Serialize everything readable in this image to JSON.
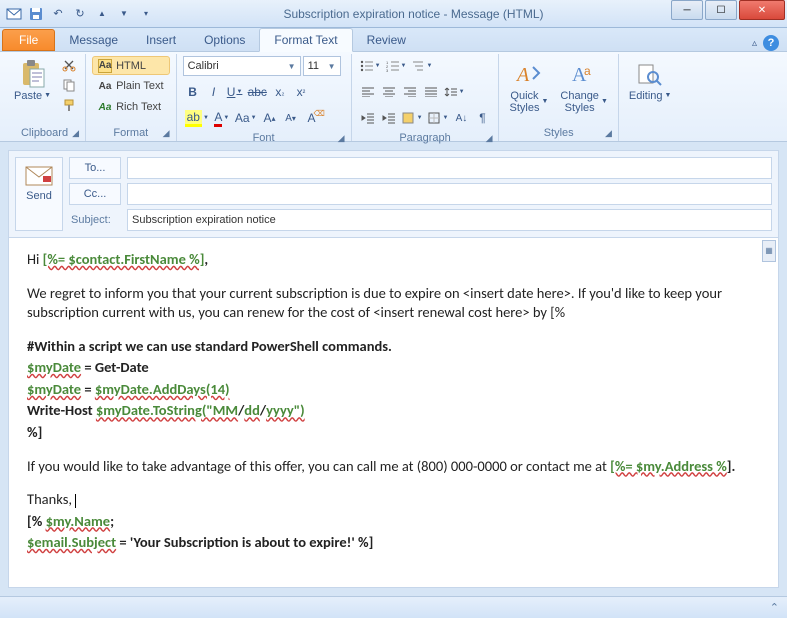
{
  "window": {
    "title": "Subscription expiration notice  -  Message (HTML)"
  },
  "qat": {
    "save": "💾",
    "undo": "↶",
    "redo": "↻",
    "prev": "▲",
    "next": "▼"
  },
  "tabs": {
    "file": "File",
    "message": "Message",
    "insert": "Insert",
    "options": "Options",
    "format_text": "Format Text",
    "review": "Review"
  },
  "ribbon": {
    "clipboard": {
      "paste": "Paste",
      "label": "Clipboard"
    },
    "format": {
      "html": "HTML",
      "plain": "Plain Text",
      "rich": "Rich Text",
      "label": "Format"
    },
    "font": {
      "family": "Calibri",
      "size": "11",
      "label": "Font"
    },
    "paragraph": {
      "label": "Paragraph"
    },
    "styles": {
      "quick": "Quick\nStyles",
      "change": "Change\nStyles",
      "label": "Styles"
    },
    "editing": {
      "label": "Editing"
    }
  },
  "compose": {
    "send": "Send",
    "to_btn": "To...",
    "cc_btn": "Cc...",
    "subject_label": "Subject:",
    "to_value": "",
    "cc_value": "",
    "subject_value": "Subscription expiration notice"
  },
  "body": {
    "l1a": "Hi ",
    "l1b": "[%= $contact.FirstName %]",
    "l1c": ",",
    "l2": "We regret to inform you that your current subscription is due to expire on <insert date here>. If you'd like to keep your subscription current with us, you can renew for the cost of <insert renewal cost here> by [%",
    "l3": "#Within a script we can use standard PowerShell commands.",
    "l4a": "$myDate",
    "l4b": " = Get-Date",
    "l5a": "$myDate",
    "l5b": " = ",
    "l5c": "$myDate.AddDays(14)",
    "l6a": "Write-Host ",
    "l6b": "$myDate.ToString(\"MM",
    "l6c": "/",
    "l6d": "dd",
    "l6e": "/",
    "l6f": "yyyy\")",
    "l7": "%]",
    "l8a": "If you would like to take advantage of this offer, you can call me at (800) 000-0000 or contact me at ",
    "l8b": "[%= $my.Address %",
    "l8c": "].",
    "l9": "Thanks, ",
    "l10a": "[% ",
    "l10b": "$my.Name",
    "l10c": ";",
    "l11a": "$email.Subject",
    "l11b": " = 'Your Subscription is about to expire!' %]"
  }
}
